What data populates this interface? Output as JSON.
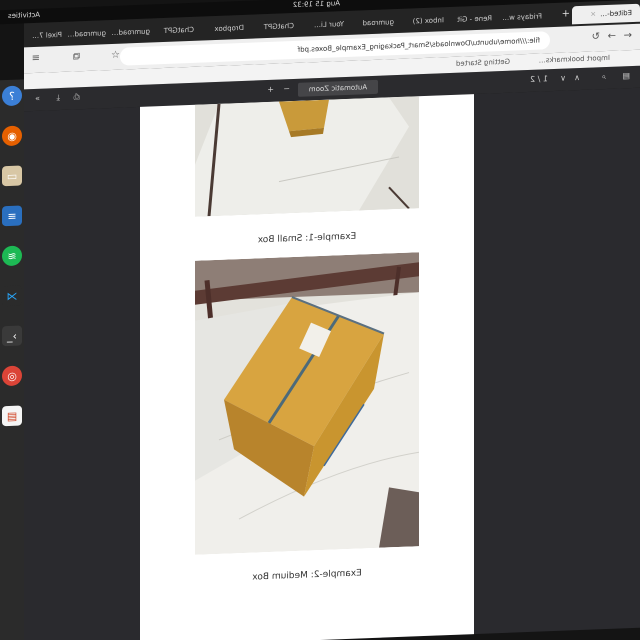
{
  "topbar": {
    "clock": "Aug 15 19:32",
    "tray": "⏻ 🔊 ⚡",
    "activities": "Activities"
  },
  "tabs": [
    {
      "label": "Fridays w…"
    },
    {
      "label": "Rene - Git"
    },
    {
      "label": "Inbox (2)"
    },
    {
      "label": "gumroad"
    },
    {
      "label": "Your Li…"
    },
    {
      "label": "ChatGPT"
    },
    {
      "label": "Dropbox"
    },
    {
      "label": "ChatGPT"
    },
    {
      "label": "gumroad…"
    },
    {
      "label": "gumroad…"
    },
    {
      "label": "Pixel 7…"
    },
    {
      "label": "Edited-…"
    }
  ],
  "address": {
    "url": "file:///home/ubuntu/Downloads/Smart_Packaging_Example_Boxes.pdf"
  },
  "bookmarks": [
    "Import bookmarks…",
    "Getting Started"
  ],
  "pdf": {
    "page_indicator": "1 / 2",
    "zoom": "Automatic Zoom"
  },
  "page": {
    "caption1": "Example-1: Small Box",
    "caption2": "Example-2: Medium Box"
  },
  "dock": [
    "help-icon",
    "firefox-icon",
    "files-icon",
    "writer-icon",
    "spotify-icon",
    "vscode-icon",
    "terminal-icon",
    "chrome-icon",
    "impress-icon"
  ]
}
